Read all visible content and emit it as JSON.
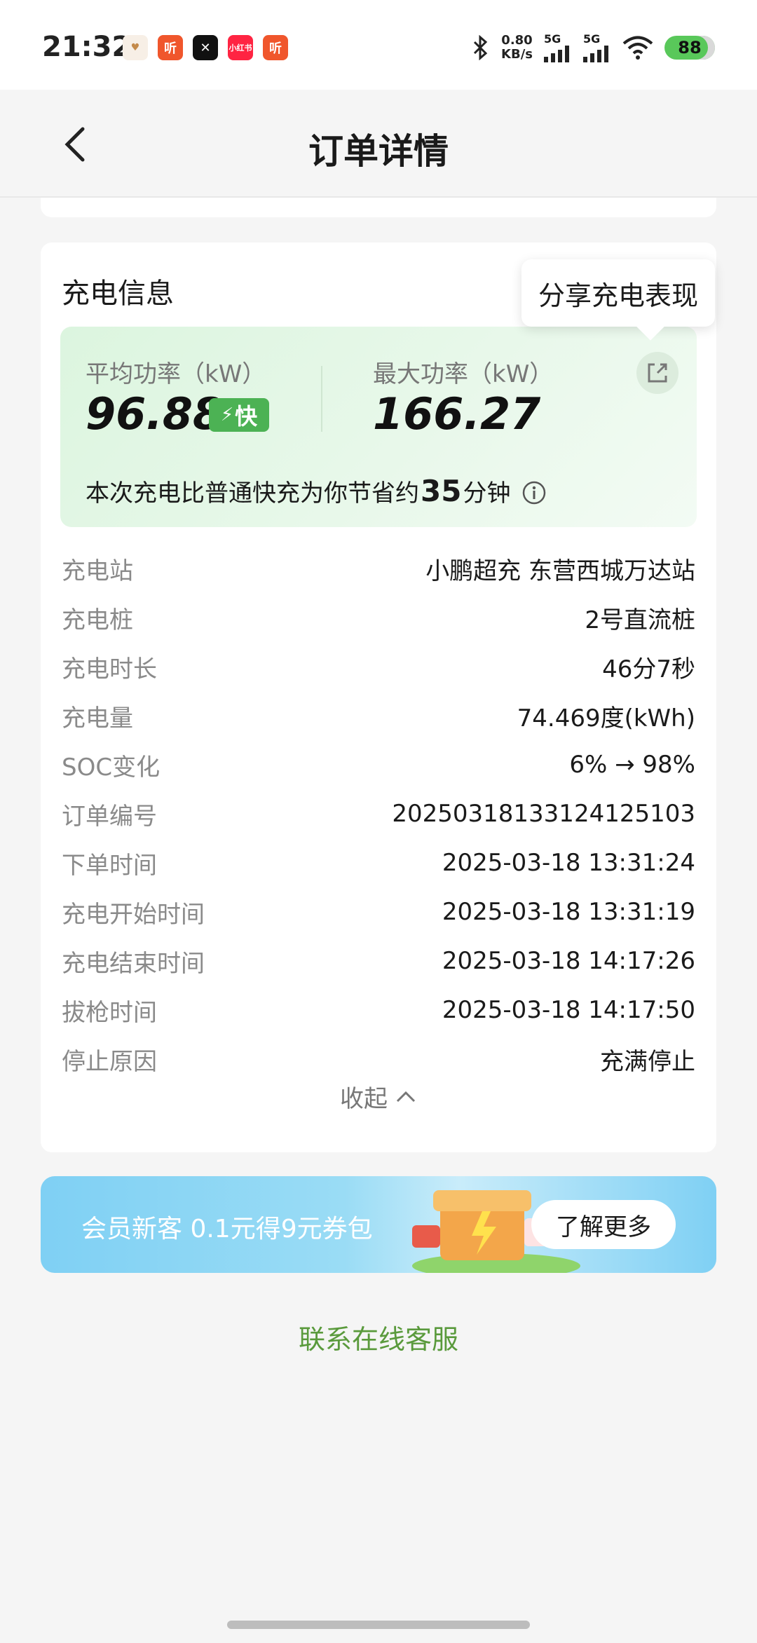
{
  "status_bar": {
    "time": "21:32",
    "notifications": [
      "听",
      "✕",
      "小红书",
      "听"
    ],
    "net_speed_value": "0.80",
    "net_speed_unit": "KB/s",
    "signal_1": "5G",
    "signal_2": "5G",
    "battery": "88"
  },
  "header": {
    "title": "订单详情"
  },
  "charge_info": {
    "section_title": "充电信息",
    "share_tooltip": "分享充电表现",
    "avg_power_label": "平均功率（kW）",
    "avg_power_value": "96.88",
    "fast_badge": "快",
    "max_power_label": "最大功率（kW）",
    "max_power_value": "166.27",
    "saving_prefix": "本次充电比普通快充为你节省约",
    "saving_minutes": "35",
    "saving_suffix": "分钟"
  },
  "details": [
    {
      "label": "充电站",
      "value": "小鹏超充 东营西城万达站"
    },
    {
      "label": "充电桩",
      "value": "2号直流桩"
    },
    {
      "label": "充电时长",
      "value": "46分7秒"
    },
    {
      "label": "充电量",
      "value": "74.469度(kWh)"
    },
    {
      "label": "SOC变化",
      "value": "6% → 98%"
    },
    {
      "label": "订单编号",
      "value": "20250318133124125103"
    },
    {
      "label": "下单时间",
      "value": "2025-03-18 13:31:24"
    },
    {
      "label": "充电开始时间",
      "value": "2025-03-18 13:31:19"
    },
    {
      "label": "充电结束时间",
      "value": "2025-03-18 14:17:26"
    },
    {
      "label": "拔枪时间",
      "value": "2025-03-18 14:17:50"
    },
    {
      "label": "停止原因",
      "value": "充满停止"
    }
  ],
  "collapse_label": "收起",
  "promo": {
    "text": "会员新客 0.1元得9元券包",
    "button": "了解更多"
  },
  "service_link": "联系在线客服",
  "colors": {
    "accent_green": "#4cb254",
    "service_link": "#5a9a3c",
    "promo_blue": "#7fd0f4"
  }
}
